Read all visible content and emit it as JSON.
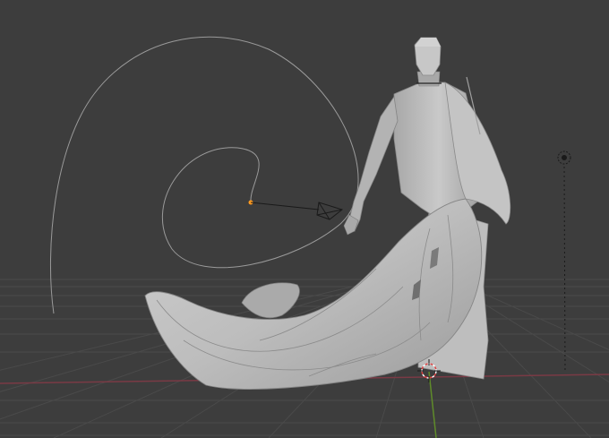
{
  "viewport": {
    "mode": "3d-viewport",
    "shading": "solid",
    "background_color": "#3d3d3d",
    "grid_color": "#4a4a4a",
    "x_axis_color": "#7a3a45",
    "y_axis_color": "#5f8b2a",
    "z_axis_color": "#555555",
    "mesh_color": "#b9b9b9",
    "curve_color": "#9a9a9a",
    "selected_point_color": "#ff9a1f"
  },
  "objects": [
    {
      "name": "figure-mesh",
      "icon": "mesh-icon"
    },
    {
      "name": "spiral-curve",
      "icon": "curve-icon"
    },
    {
      "name": "camera",
      "icon": "camera-icon"
    },
    {
      "name": "light",
      "icon": "light-icon"
    },
    {
      "name": "3d-cursor",
      "icon": "cursor-icon"
    }
  ]
}
